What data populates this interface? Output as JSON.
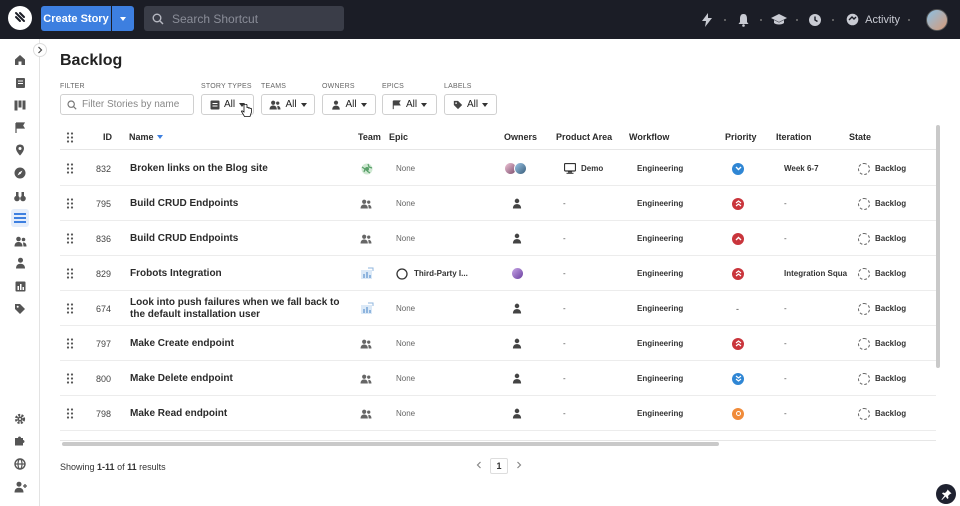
{
  "topbar": {
    "create_label": "Create Story",
    "search_placeholder": "Search Shortcut",
    "activity_label": "Activity"
  },
  "page": {
    "title": "Backlog"
  },
  "filters": {
    "filter_label": "FILTER",
    "filter_placeholder": "Filter Stories by name",
    "story_types": {
      "label": "STORY TYPES",
      "value": "All"
    },
    "teams": {
      "label": "TEAMS",
      "value": "All"
    },
    "owners": {
      "label": "OWNERS",
      "value": "All"
    },
    "epics": {
      "label": "EPICS",
      "value": "All"
    },
    "labels": {
      "label": "LABELS",
      "value": "All"
    }
  },
  "table": {
    "columns": {
      "id": "ID",
      "name": "Name",
      "team": "Team",
      "epic": "Epic",
      "owners": "Owners",
      "product_area": "Product Area",
      "workflow": "Workflow",
      "priority": "Priority",
      "iteration": "Iteration",
      "state": "State"
    },
    "rows": [
      {
        "id": "832",
        "name": "Broken links on the Blog site",
        "team_icon": "globe-team-icon",
        "epic": "None",
        "owners": "two-avatars",
        "product_area": "Demo",
        "workflow": "Engineering",
        "priority": "low",
        "iteration": "Week 6-7",
        "state": "Backlog"
      },
      {
        "id": "795",
        "name": "Build CRUD Endpoints",
        "team_icon": "people-icon",
        "epic": "None",
        "owners": "empty",
        "product_area": "-",
        "workflow": "Engineering",
        "priority": "highest",
        "iteration": "-",
        "state": "Backlog"
      },
      {
        "id": "836",
        "name": "Build CRUD Endpoints",
        "team_icon": "people-icon",
        "epic": "None",
        "owners": "empty",
        "product_area": "-",
        "workflow": "Engineering",
        "priority": "high",
        "iteration": "-",
        "state": "Backlog"
      },
      {
        "id": "829",
        "name": "Frobots Integration",
        "team_icon": "chart-team-icon",
        "epic": "Third-Party I...",
        "owners": "one-avatar",
        "product_area": "-",
        "workflow": "Engineering",
        "priority": "highest",
        "iteration": "Integration Squa",
        "state": "Backlog"
      },
      {
        "id": "674",
        "name": "Look into push failures when we fall back to the default installation user",
        "team_icon": "chart-team-icon",
        "epic": "None",
        "owners": "empty",
        "product_area": "-",
        "workflow": "Engineering",
        "priority": "-",
        "iteration": "-",
        "state": "Backlog"
      },
      {
        "id": "797",
        "name": "Make Create endpoint",
        "team_icon": "people-icon",
        "epic": "None",
        "owners": "empty",
        "product_area": "-",
        "workflow": "Engineering",
        "priority": "highest",
        "iteration": "-",
        "state": "Backlog"
      },
      {
        "id": "800",
        "name": "Make Delete endpoint",
        "team_icon": "people-icon",
        "epic": "None",
        "owners": "empty",
        "product_area": "-",
        "workflow": "Engineering",
        "priority": "lowest",
        "iteration": "-",
        "state": "Backlog"
      },
      {
        "id": "798",
        "name": "Make Read endpoint",
        "team_icon": "people-icon",
        "epic": "None",
        "owners": "empty",
        "product_area": "-",
        "workflow": "Engineering",
        "priority": "medium",
        "iteration": "-",
        "state": "Backlog"
      }
    ]
  },
  "footer": {
    "showing_prefix": "Showing ",
    "range": "1-11",
    "of": " of ",
    "total": "11",
    "suffix": " results",
    "page": "1"
  },
  "colors": {
    "accent": "#3d7fe0",
    "topbar": "#1b1d26",
    "priority_high": "#c9353c",
    "priority_low": "#2f86d4",
    "priority_medium": "#f08b3a"
  }
}
